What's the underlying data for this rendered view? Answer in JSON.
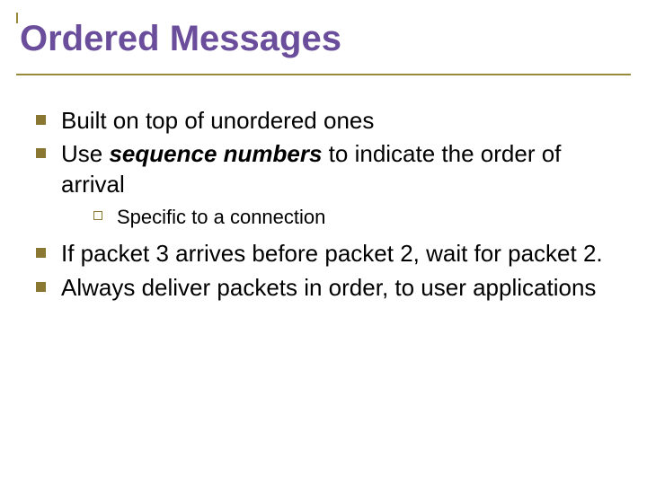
{
  "title": "Ordered Messages",
  "bullets": {
    "b1": "Built on top of unordered ones",
    "b2_pre": "Use ",
    "b2_em": "sequence numbers",
    "b2_post": " to indicate the order of arrival",
    "b2_sub1": "Specific to a connection",
    "b3": "If packet 3 arrives before packet 2, wait for packet 2.",
    "b4": "Always deliver packets in order, to user applications"
  }
}
